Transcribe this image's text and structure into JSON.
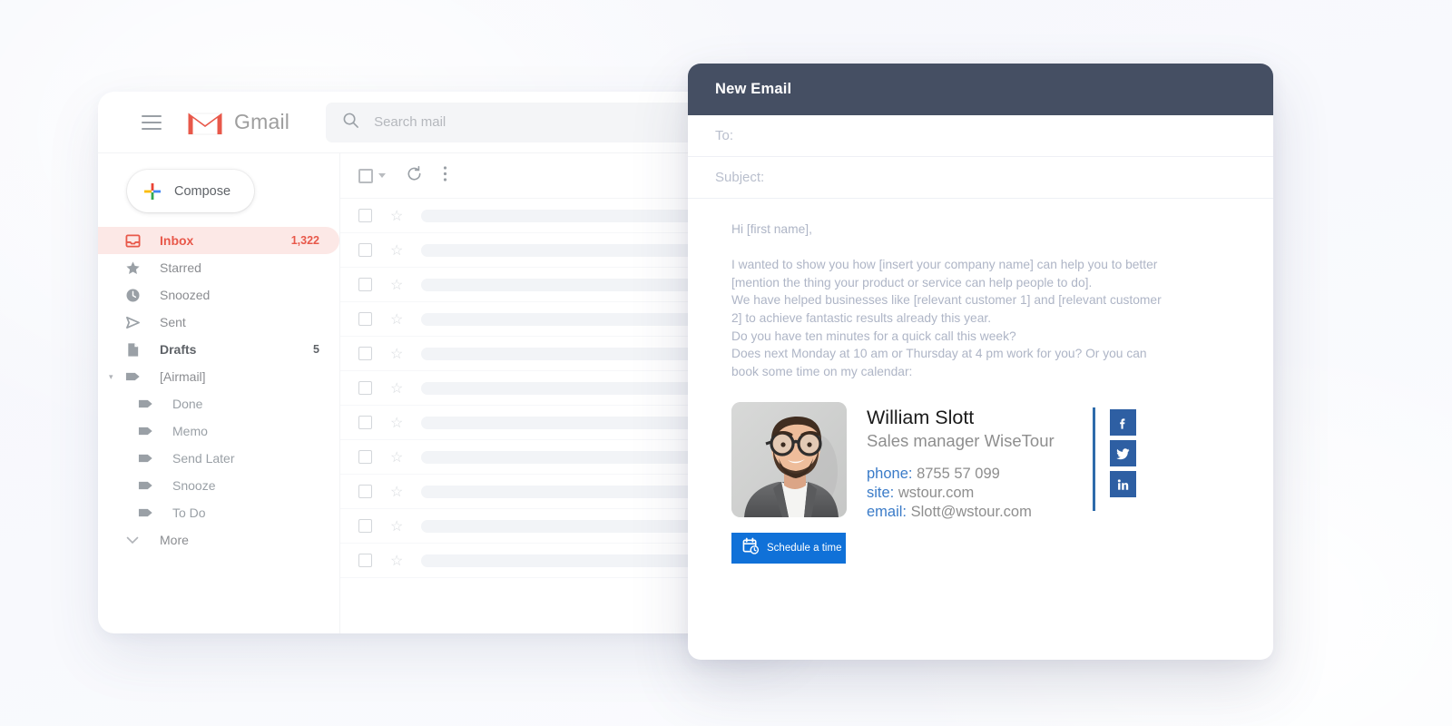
{
  "background": {
    "base_color": "#f7f8fc"
  },
  "gmail": {
    "brand": "Gmail",
    "menu_icon": "hamburger-icon",
    "search": {
      "placeholder": "Search mail",
      "icon": "search-icon"
    },
    "compose": {
      "label": "Compose",
      "icon": "plus-icon"
    },
    "nav": [
      {
        "label": "Inbox",
        "count": "1,322",
        "icon": "inbox-icon",
        "state": "active"
      },
      {
        "label": "Starred",
        "count": "",
        "icon": "star-icon",
        "state": "normal"
      },
      {
        "label": "Snoozed",
        "count": "",
        "icon": "clock-icon",
        "state": "normal"
      },
      {
        "label": "Sent",
        "count": "",
        "icon": "send-icon",
        "state": "normal"
      },
      {
        "label": "Drafts",
        "count": "5",
        "icon": "draft-icon",
        "state": "bold"
      },
      {
        "label": "[Airmail]",
        "count": "",
        "icon": "label-icon",
        "state": "normal",
        "caret": "expanded"
      },
      {
        "label": "Done",
        "count": "",
        "icon": "label-icon",
        "state": "sub"
      },
      {
        "label": "Memo",
        "count": "",
        "icon": "label-icon",
        "state": "sub"
      },
      {
        "label": "Send Later",
        "count": "",
        "icon": "label-icon",
        "state": "sub"
      },
      {
        "label": "Snooze",
        "count": "",
        "icon": "label-icon",
        "state": "sub"
      },
      {
        "label": "To Do",
        "count": "",
        "icon": "label-icon",
        "state": "sub"
      },
      {
        "label": "More",
        "count": "",
        "icon": "chevron-down-icon",
        "state": "more"
      }
    ],
    "toolbar": {
      "select_all": "select-all-checkbox",
      "refresh": "refresh-icon",
      "more": "more-vertical-icon"
    },
    "list_rows": 11
  },
  "compose": {
    "title": "New Email",
    "header_color": "#454f63",
    "to_label": "To:",
    "subject_label": "Subject:",
    "body": "Hi [first name],\n\nI wanted to show you how [insert your company name] can help you to better\n[mention the thing your product or service can help people to do].\nWe have helped businesses like [relevant customer 1] and [relevant customer\n2] to achieve fantastic results already this year.\nDo you have ten minutes for a quick call this week?\nDoes next Monday at 10 am or Thursday at 4 pm work for you? Or you can\nbook some time on my calendar:",
    "signature": {
      "photo_alt": "portrait-of-bearded-man-with-glasses-in-grey-suit",
      "name": "William Slott",
      "role": "Sales manager WiseTour",
      "phone_label": "phone:",
      "phone_value": "8755 57 099",
      "site_label": "site:",
      "site_value": "wstour.com",
      "email_label": "email:",
      "email_value": "Slott@wstour.com",
      "label_color": "#3a7bc8",
      "divider_color": "#2e6bab",
      "social": [
        {
          "name": "facebook-icon",
          "glyph": "f"
        },
        {
          "name": "twitter-icon",
          "glyph": "t"
        },
        {
          "name": "linkedin-icon",
          "glyph": "in"
        }
      ],
      "social_color": "#2e5fa3"
    },
    "schedule_button": {
      "label": "Schedule a time",
      "icon": "calendar-clock-icon",
      "color": "#1071d8"
    }
  }
}
